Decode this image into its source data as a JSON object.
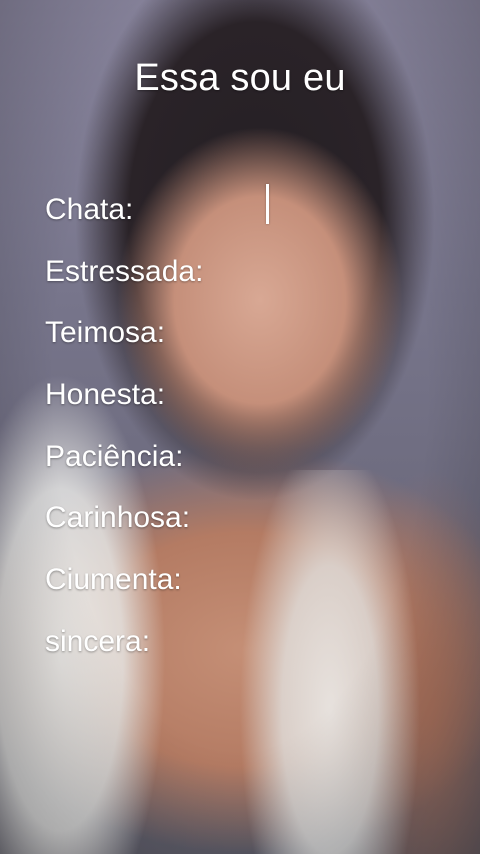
{
  "title": "Essa sou eu",
  "traits": [
    "Chata:",
    "Estressada:",
    "Teimosa:",
    "Honesta:",
    "Paciência:",
    "Carinhosa:",
    "Ciumenta:",
    "sincera:"
  ],
  "colors": {
    "text": "#ffffff",
    "background": "#6e6a78"
  }
}
